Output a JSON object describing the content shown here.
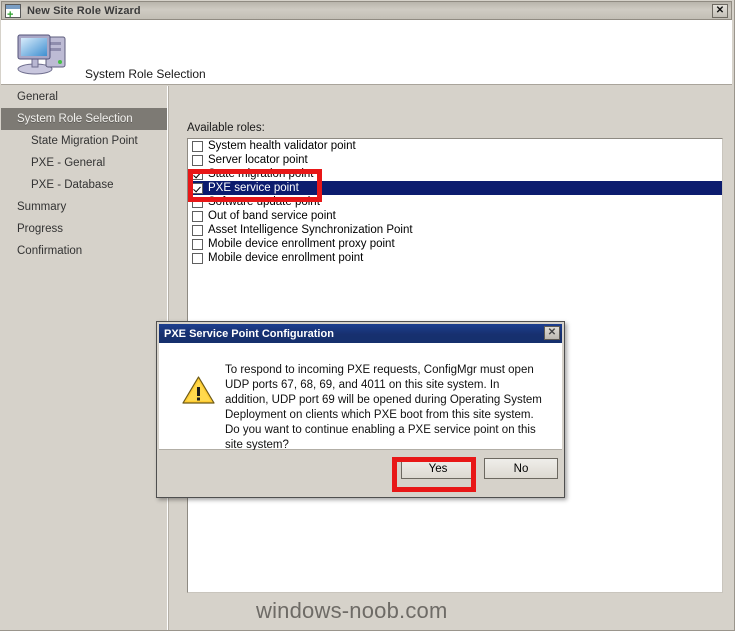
{
  "window": {
    "title": "New Site Role Wizard",
    "icon": "new-window-icon",
    "close_label": "✕",
    "header_title": "System Role Selection",
    "header_icon": "computer-icon"
  },
  "sidebar": {
    "items": [
      {
        "label": "General",
        "level": 1,
        "selected": false
      },
      {
        "label": "System Role Selection",
        "level": 1,
        "selected": true
      },
      {
        "label": "State Migration Point",
        "level": 2,
        "selected": false
      },
      {
        "label": "PXE - General",
        "level": 2,
        "selected": false
      },
      {
        "label": "PXE - Database",
        "level": 2,
        "selected": false
      },
      {
        "label": "Summary",
        "level": 1,
        "selected": false
      },
      {
        "label": "Progress",
        "level": 1,
        "selected": false
      },
      {
        "label": "Confirmation",
        "level": 1,
        "selected": false
      }
    ]
  },
  "main": {
    "available_roles_label": "Available roles:",
    "roles": [
      {
        "label": "System health validator point",
        "checked": false,
        "selected": false
      },
      {
        "label": "Server locator point",
        "checked": false,
        "selected": false
      },
      {
        "label": "State migration point",
        "checked": true,
        "selected": false
      },
      {
        "label": "PXE service point",
        "checked": true,
        "selected": true
      },
      {
        "label": "Software update point",
        "checked": false,
        "selected": false
      },
      {
        "label": "Out of band service point",
        "checked": false,
        "selected": false
      },
      {
        "label": "Asset Intelligence Synchronization Point",
        "checked": false,
        "selected": false
      },
      {
        "label": "Mobile device enrollment proxy point",
        "checked": false,
        "selected": false
      },
      {
        "label": "Mobile device enrollment point",
        "checked": false,
        "selected": false
      }
    ]
  },
  "dialog": {
    "title": "PXE Service Point Configuration",
    "close_label": "✕",
    "icon": "warning-icon",
    "message": "To respond to incoming PXE requests, ConfigMgr must open UDP ports 67, 68, 69, and 4011 on this site system. In addition, UDP port 69 will be opened during Operating System Deployment on clients which PXE boot from  this site system. Do you want to continue enabling a PXE service point on this site system?",
    "yes_label": "Yes",
    "no_label": "No"
  },
  "annotations": {
    "highlight_color": "#e81717",
    "roles_highlight_target": "state-migration-and-pxe-rows",
    "button_highlight_target": "yes-button"
  },
  "watermark": {
    "text": "windows-noob.com"
  },
  "colors": {
    "window_bg": "#d6d2ca",
    "selection_blue": "#0c1c6e",
    "dialog_titlebar": "#17306f",
    "nav_selected": "#7d7a74",
    "annotation_red": "#e81717"
  }
}
